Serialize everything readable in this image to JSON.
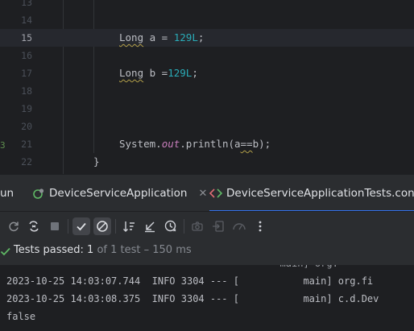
{
  "editor": {
    "lines": [
      {
        "num": "13",
        "current": false
      },
      {
        "num": "14",
        "current": false
      },
      {
        "num": "15",
        "current": true,
        "type": "Long",
        "rest": " a = ",
        "num_lit": "129L",
        "end": ";"
      },
      {
        "num": "16",
        "current": false
      },
      {
        "num": "17",
        "current": false,
        "type": "Long",
        "rest": " b =",
        "num_lit": "129L",
        "end": ";"
      },
      {
        "num": "18",
        "current": false
      },
      {
        "num": "19",
        "current": false
      },
      {
        "num": "20",
        "current": false
      },
      {
        "num": "21",
        "current": false,
        "sys": "System.",
        "field": "out",
        "call": ".println(a",
        "op": "==",
        "call_end": "b);"
      },
      {
        "num": "22",
        "current": false,
        "brace": "}"
      }
    ],
    "gutter_mark": "3"
  },
  "tabs": {
    "run_label": "un",
    "tab1": "DeviceServiceApplication",
    "tab2": "DeviceServiceApplicationTests.conte"
  },
  "icons": {
    "rerun": "rerun-icon",
    "rerun_failed": "rerun-failed-icon",
    "stop": "stop-icon",
    "show_passed": "check-icon",
    "show_ignored": "ignored-icon",
    "sort": "sort-icon",
    "collapse": "collapse-icon",
    "history": "history-icon",
    "screenshot": "camera-icon",
    "import": "import-icon",
    "coverage": "coverage-icon",
    "more": "more-icon"
  },
  "status": {
    "label": "Tests passed: ",
    "count": "1",
    "detail": " of 1 test – 150 ms"
  },
  "console": {
    "partial": "                                               main] org.",
    "lines": [
      "2023-10-25 14:03:07.744  INFO 3304 --- [           main] org.fi",
      "2023-10-25 14:03:08.375  INFO 3304 --- [           main] c.d.Dev",
      "false"
    ]
  },
  "colors": {
    "accent": "#3574f0",
    "number": "#2aacb8",
    "field": "#c77dbb",
    "pass": "#5fb865"
  }
}
